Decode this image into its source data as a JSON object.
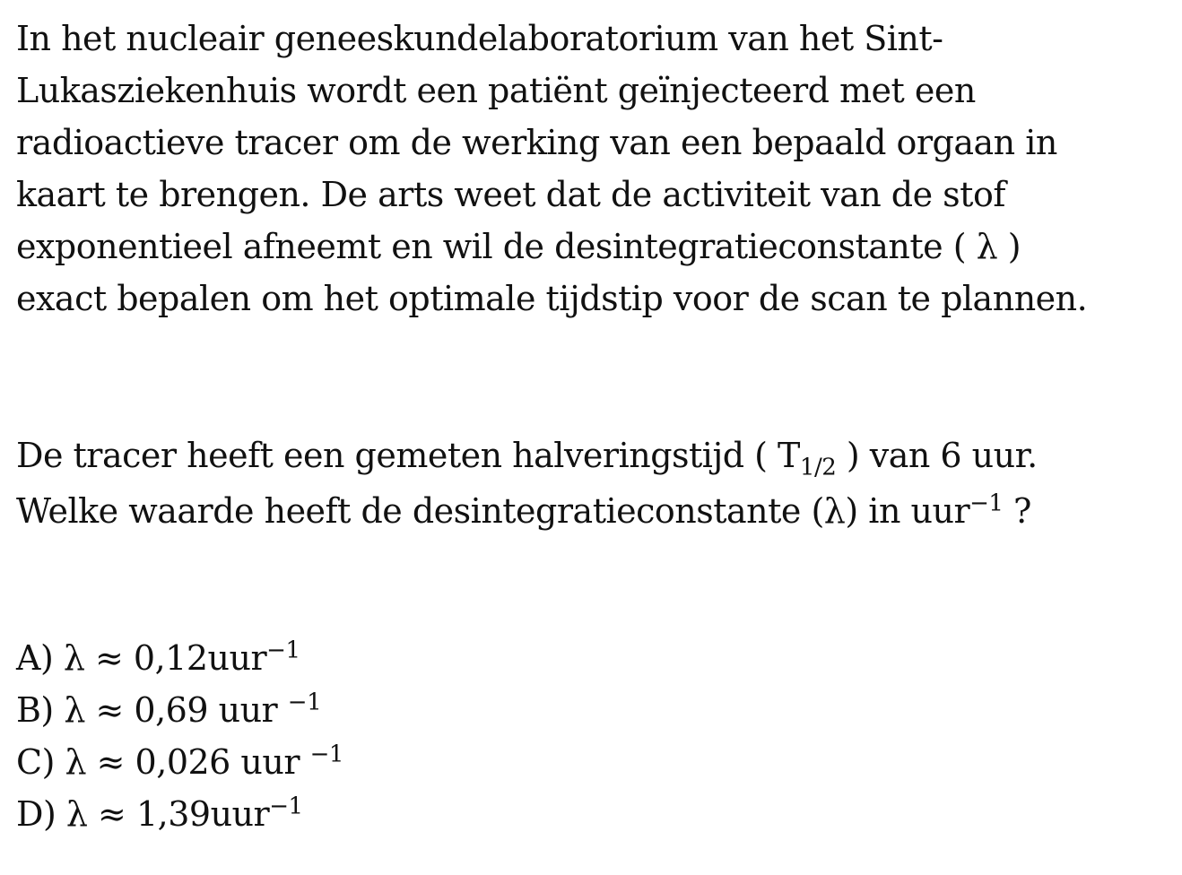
{
  "intro": {
    "lines": [
      "In het nucleair geneeskundelaboratorium van het Sint-",
      "Lukasziekenhuis wordt een patiënt geïnjecteerd met een",
      "radioactieve tracer om de werking van een bepaald orgaan in",
      "kaart te brengen. De arts weet dat de activiteit van de stof",
      "exponentieel afneemt en wil de desintegratieconstante ( λ )",
      "exact bepalen om het optimale tijdstip voor de scan te plannen."
    ]
  },
  "question": {
    "line1_before": "De tracer heeft een gemeten halveringstijd ( T",
    "line1_sub": "1/2",
    "line1_after": " ) van 6 uur.",
    "line2_before": "Welke waarde heeft de desintegratieconstante (λ) in uur",
    "line2_sup": "−1",
    "line2_after": " ?"
  },
  "options": [
    {
      "text": "A) λ ≈ 0,12uur",
      "sup": "−1"
    },
    {
      "text": "B) λ ≈ 0,69 uur ",
      "sup": "−1"
    },
    {
      "text": "C) λ ≈ 0,026 uur ",
      "sup": "−1"
    },
    {
      "text": "D) λ ≈ 1,39uur",
      "sup": "−1"
    }
  ]
}
